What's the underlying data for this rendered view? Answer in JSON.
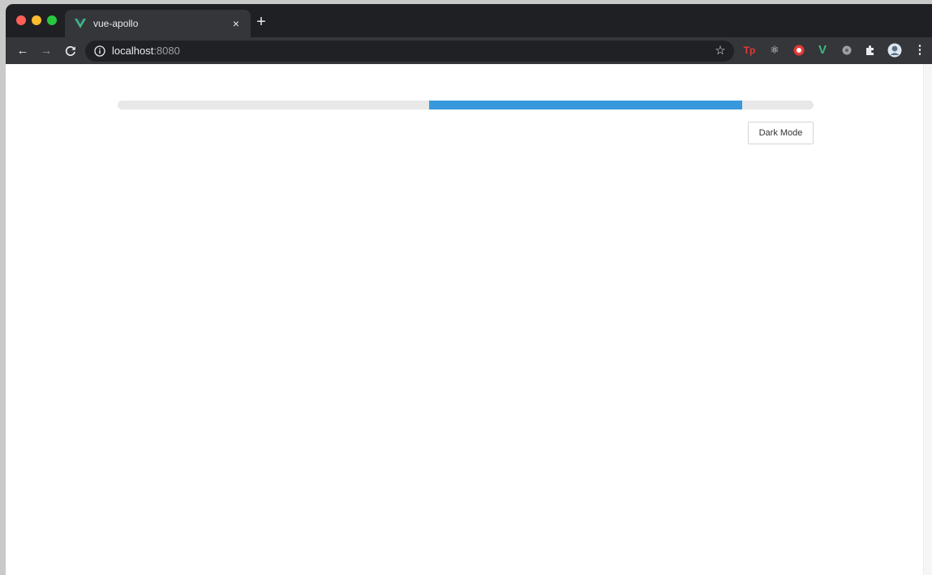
{
  "browser": {
    "tab": {
      "title": "vue-apollo",
      "favicon": "vue-logo-icon",
      "close_label": "×"
    },
    "new_tab_label": "+",
    "nav": {
      "back_label": "←",
      "forward_label": "→",
      "reload_label": "C"
    },
    "omnibox": {
      "host": "localhost",
      "port": ":8080",
      "info_icon": "info-icon",
      "bookmark_icon": "star-icon"
    },
    "extensions": [
      {
        "name": "tp-extension-icon",
        "label": "Tp",
        "color": "#e53935"
      },
      {
        "name": "react-devtools-icon",
        "label": "⚛",
        "color": "#e8eaed"
      },
      {
        "name": "red-circle-extension-icon",
        "label": "",
        "color": "#e53935"
      },
      {
        "name": "vue-devtools-icon",
        "label": "V",
        "color": "#41b883"
      },
      {
        "name": "gray-circle-extension-icon",
        "label": "",
        "color": "#9aa0a6"
      },
      {
        "name": "puzzle-icon",
        "label": "",
        "color": "#e8eaed"
      },
      {
        "name": "avatar",
        "label": "",
        "color": "#8ab4f8"
      },
      {
        "name": "kebab-menu-icon",
        "label": "⋮",
        "color": "#e8eaed"
      }
    ]
  },
  "page": {
    "progress": {
      "start_fraction": 0.447,
      "end_fraction": 0.897,
      "fill_color": "#3798dc",
      "track_color": "#e8e8e8"
    },
    "dark_mode_button": {
      "label": "Dark Mode"
    }
  }
}
